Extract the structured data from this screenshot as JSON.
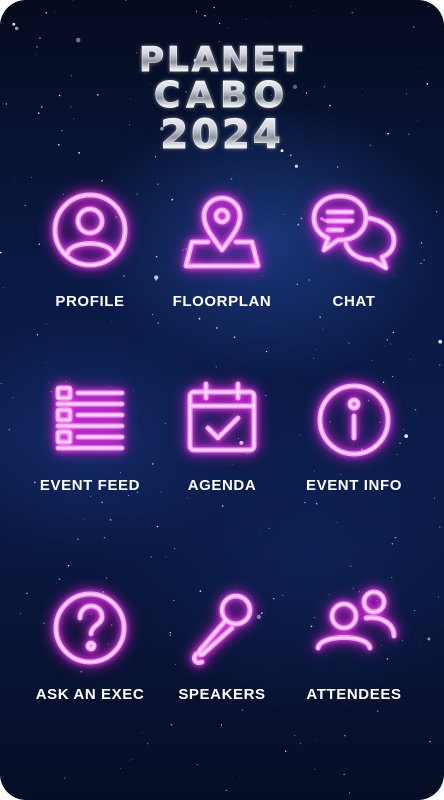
{
  "logo": {
    "line1": "PLANET",
    "line2": "CABO",
    "line3": "2024"
  },
  "menu": [
    {
      "label": "PROFILE",
      "icon": "person-circle-icon"
    },
    {
      "label": "FLOORPLAN",
      "icon": "map-pin-icon"
    },
    {
      "label": "CHAT",
      "icon": "chat-bubbles-icon"
    },
    {
      "label": "EVENT FEED",
      "icon": "list-icon"
    },
    {
      "label": "AGENDA",
      "icon": "calendar-check-icon"
    },
    {
      "label": "EVENT INFO",
      "icon": "info-circle-icon"
    },
    {
      "label": "ASK AN EXEC",
      "icon": "question-circle-icon"
    },
    {
      "label": "SPEAKERS",
      "icon": "microphone-icon"
    },
    {
      "label": "ATTENDEES",
      "icon": "people-icon"
    }
  ],
  "colors": {
    "neon": "#ff9cff",
    "background": "#0a1a45",
    "label": "#ffffff"
  }
}
